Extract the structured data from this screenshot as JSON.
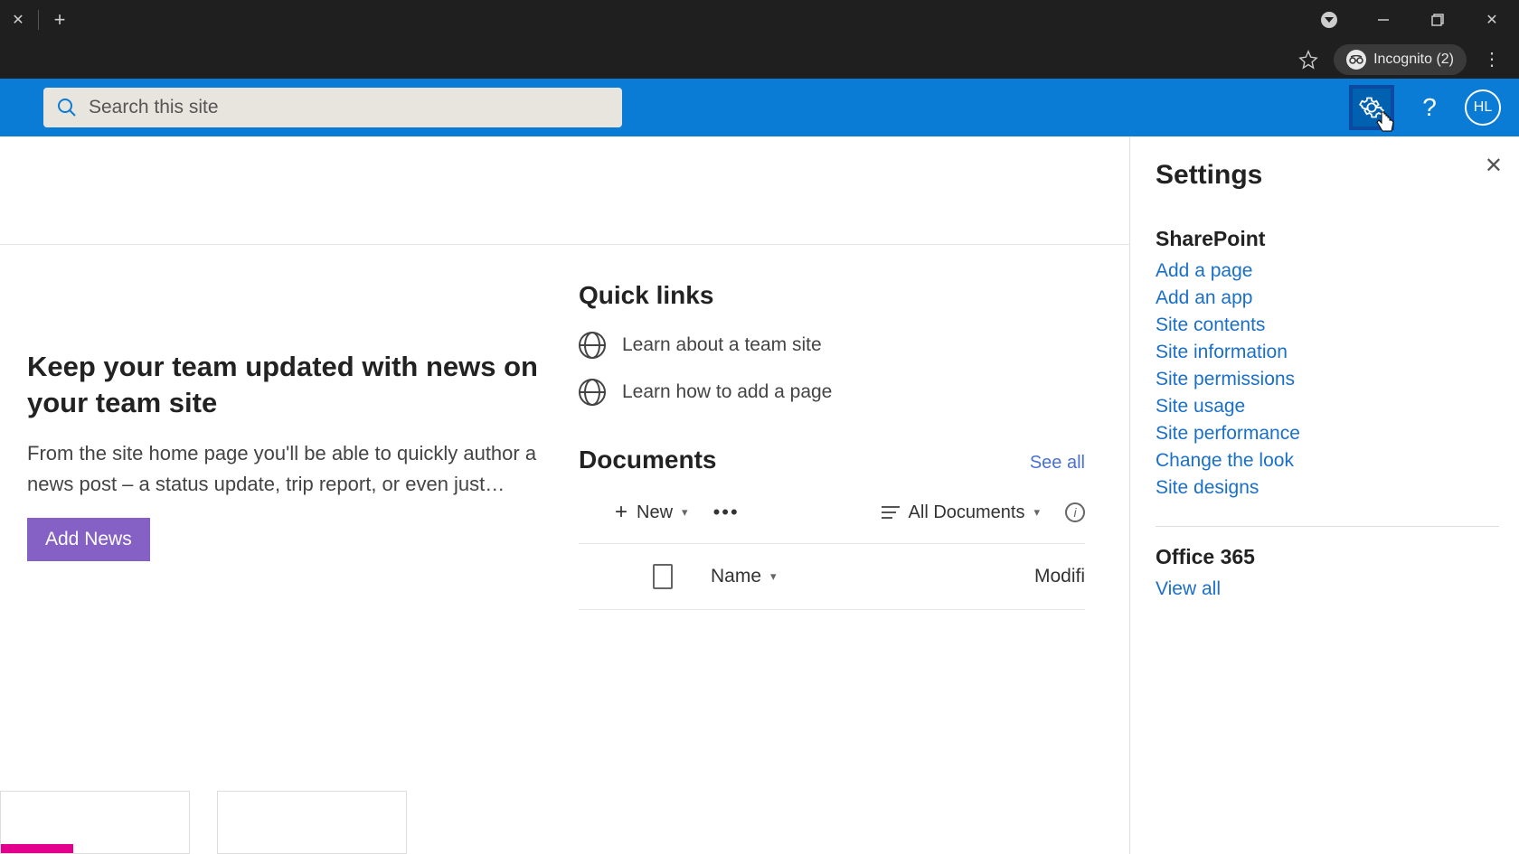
{
  "browser": {
    "incognito_label": "Incognito (2)"
  },
  "header": {
    "search_placeholder": "Search this site",
    "avatar_initials": "HL"
  },
  "news": {
    "title": "Keep your team updated with news on your team site",
    "body": "From the site home page you'll be able to quickly author a news post – a status update, trip report, or even just…",
    "add_button": "Add News"
  },
  "quicklinks": {
    "heading": "Quick links",
    "items": [
      "Learn about a team site",
      "Learn how to add a page"
    ]
  },
  "documents": {
    "heading": "Documents",
    "see_all": "See all",
    "new_label": "New",
    "view_label": "All Documents",
    "col_name": "Name",
    "col_modified": "Modifi"
  },
  "settings": {
    "title": "Settings",
    "sharepoint_heading": "SharePoint",
    "links": [
      "Add a page",
      "Add an app",
      "Site contents",
      "Site information",
      "Site permissions",
      "Site usage",
      "Site performance",
      "Change the look",
      "Site designs"
    ],
    "office_heading": "Office 365",
    "office_link": "View all"
  }
}
